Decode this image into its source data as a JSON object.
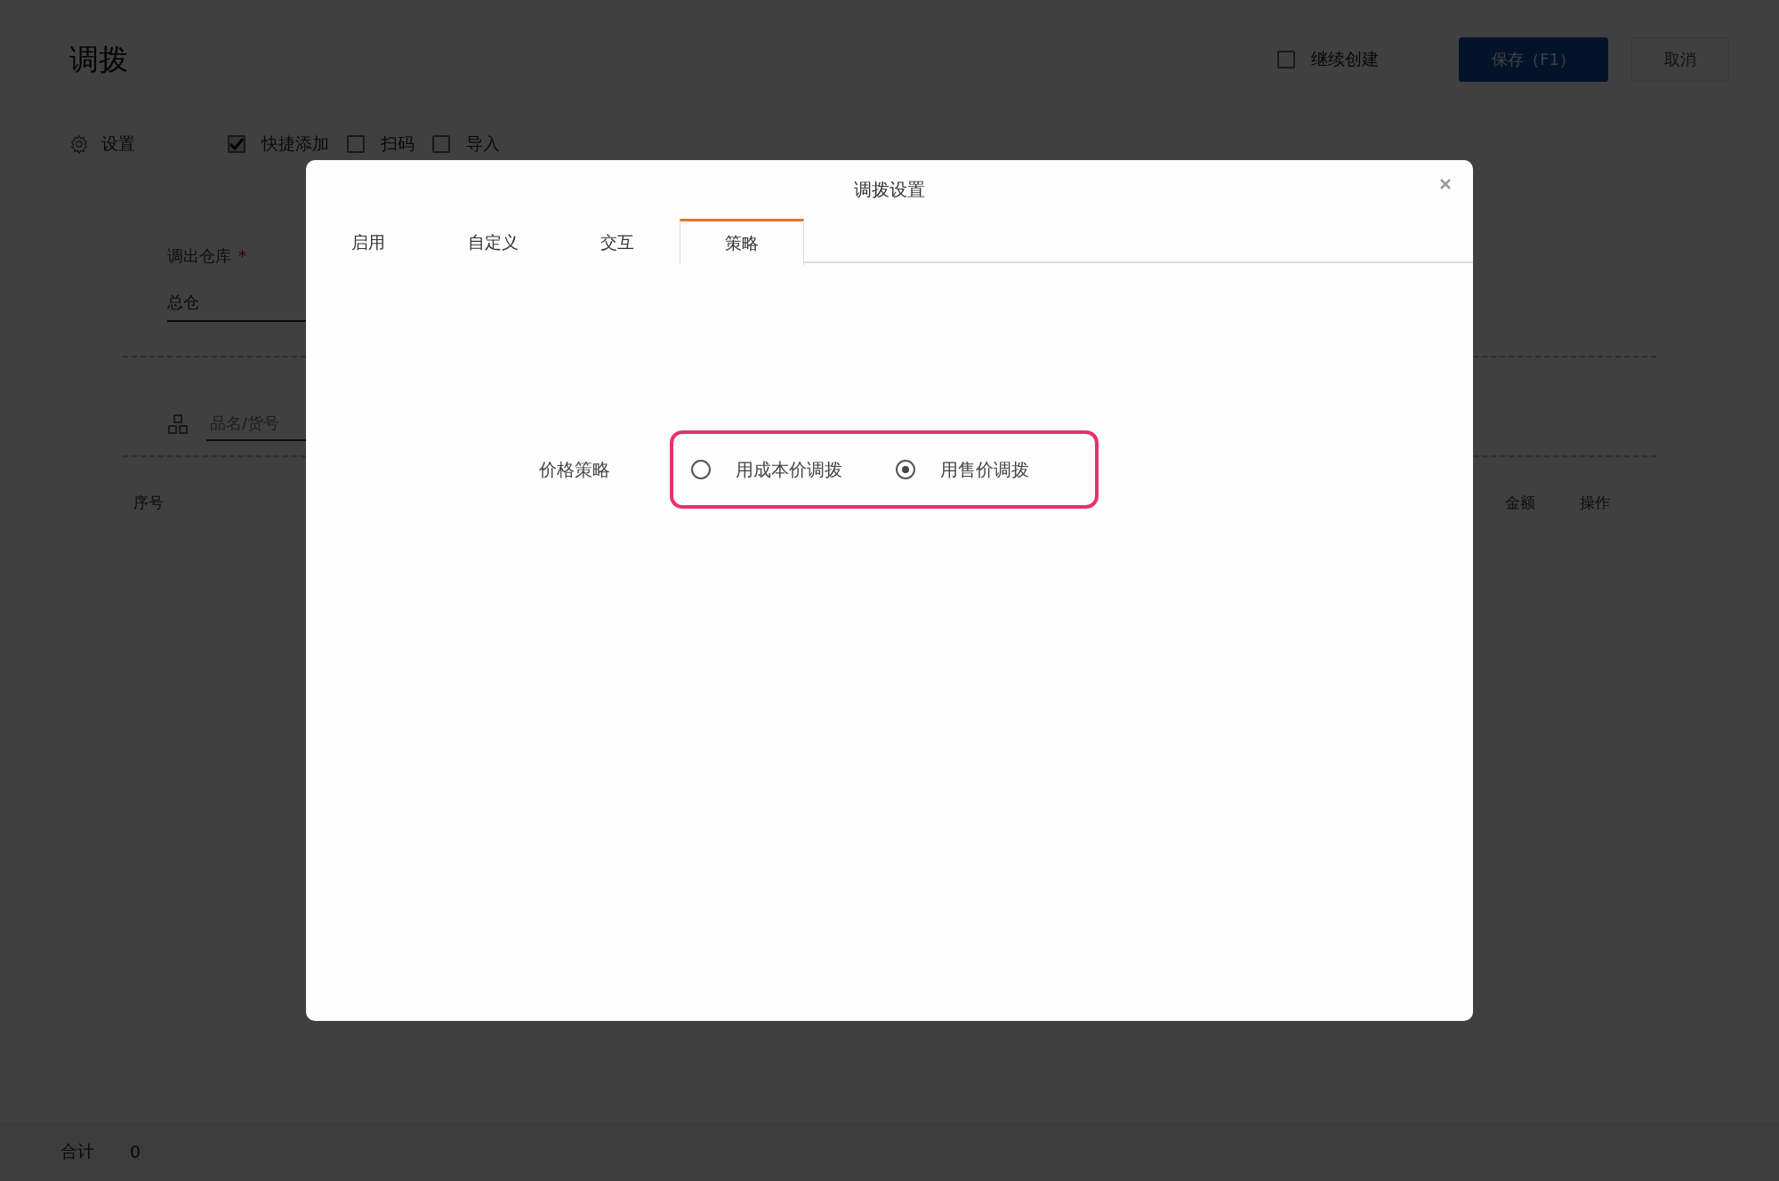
{
  "page": {
    "title": "调拨",
    "continue_create": {
      "label": "继续创建",
      "checked": false
    },
    "buttons": [
      {
        "label": "保存（F1）",
        "kind": "primary"
      },
      {
        "label": "取消",
        "kind": "secondary"
      }
    ]
  },
  "toolbar": {
    "settings": "设置",
    "options": [
      {
        "label": "快捷添加",
        "checked": true
      },
      {
        "label": "扫码",
        "checked": false
      },
      {
        "label": "导入",
        "checked": false
      }
    ]
  },
  "form": {
    "warehouse": {
      "label": "调出仓库",
      "required_mark": "*",
      "value": "总仓"
    },
    "product_search": {
      "placeholder": "品名/货号"
    }
  },
  "table": {
    "columns": [
      "序号",
      "金额",
      "操作"
    ]
  },
  "footer": {
    "label": "合计",
    "value": "0"
  },
  "dialog": {
    "title": "调拨设置",
    "tabs": [
      {
        "label": "启用",
        "selected": false
      },
      {
        "label": "自定义",
        "selected": false
      },
      {
        "label": "交互",
        "selected": false
      },
      {
        "label": "策略",
        "selected": true
      }
    ],
    "price_strategy": {
      "label": "价格策略",
      "options": [
        {
          "label": "用成本价调拨",
          "selected": false
        },
        {
          "label": "用售价调拨",
          "selected": true
        }
      ]
    }
  }
}
